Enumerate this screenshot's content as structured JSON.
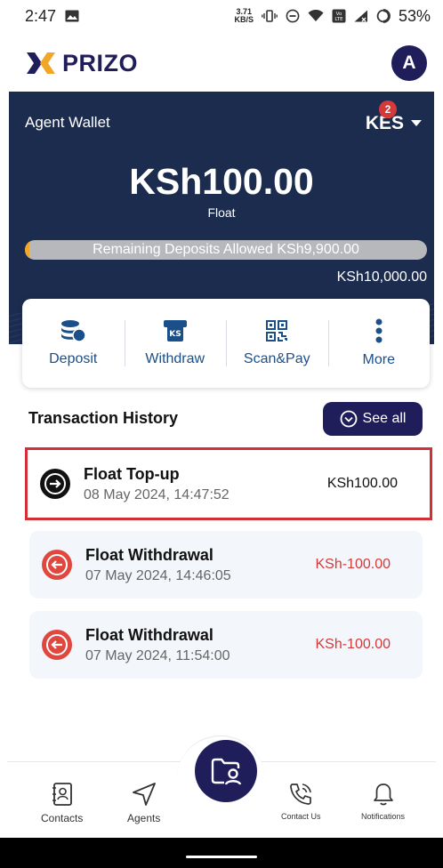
{
  "status_bar": {
    "time": "2:47",
    "net_speed_value": "3.71",
    "net_speed_unit": "KB/S",
    "battery": "53%"
  },
  "app": {
    "logo_text": "PRIZO",
    "avatar_initial": "A"
  },
  "wallet": {
    "label": "Agent Wallet",
    "currency": "KES",
    "currency_badge": "2",
    "amount": "KSh100.00",
    "amount_caption": "Float",
    "progress_text": "Remaining Deposits Allowed KSh9,900.00",
    "progress_fraction": 0.01,
    "limit": "KSh10,000.00"
  },
  "actions": [
    {
      "label": "Deposit",
      "icon": "coins-icon"
    },
    {
      "label": "Withdraw",
      "icon": "atm-icon"
    },
    {
      "label": "Scan&Pay",
      "icon": "qr-code-icon"
    },
    {
      "label": "More",
      "icon": "more-vertical-icon"
    }
  ],
  "transactions_section": {
    "title": "Transaction History",
    "see_all": "See all"
  },
  "transactions": [
    {
      "name": "Float Top-up",
      "date": "08 May 2024, 14:47:52",
      "amount": "KSh100.00",
      "type": "in"
    },
    {
      "name": "Float Withdrawal",
      "date": "07 May 2024, 14:46:05",
      "amount": "KSh-100.00",
      "type": "out"
    },
    {
      "name": "Float Withdrawal",
      "date": "07 May 2024, 11:54:00",
      "amount": "KSh-100.00",
      "type": "out"
    }
  ],
  "bottom_nav": {
    "contacts": "Contacts",
    "agents": "Agents",
    "contact_us": "Contact Us",
    "notifications": "Notifications"
  },
  "colors": {
    "brand_navy": "#1f1d5a",
    "wallet_bg": "#1b2c4f",
    "negative": "#d43a3a",
    "highlight_border": "#d23036",
    "progress_fill": "#f1a628"
  }
}
